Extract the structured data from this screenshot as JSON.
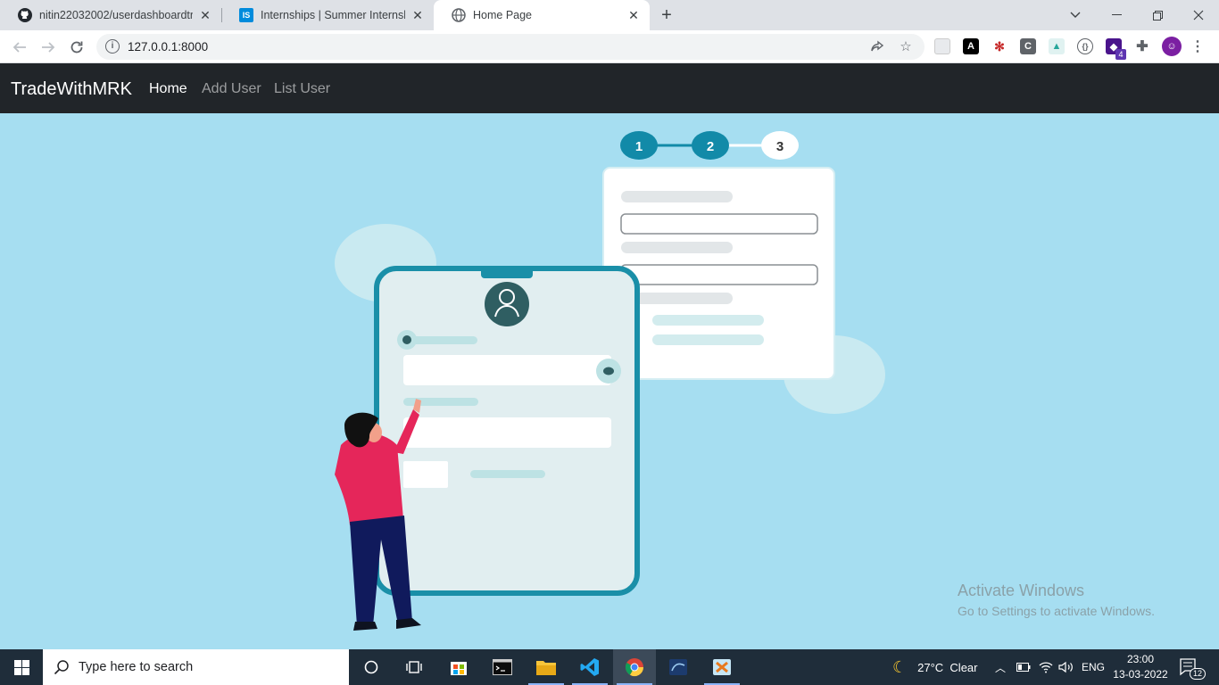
{
  "browser": {
    "tabs": [
      {
        "title": "nitin22032002/userdashboardtra",
        "icon": "github-icon"
      },
      {
        "title": "Internships | Summer Internship",
        "icon": "internshala-icon",
        "icon_text": "IS"
      },
      {
        "title": "Home Page",
        "icon": "globe-icon"
      }
    ],
    "url": "127.0.0.1:8000"
  },
  "navbar": {
    "brand": "TradeWithMRK",
    "links": [
      {
        "label": "Home",
        "active": true
      },
      {
        "label": "Add User",
        "active": false
      },
      {
        "label": "List User",
        "active": false
      }
    ]
  },
  "illustration": {
    "steps": [
      "1",
      "2",
      "3"
    ],
    "colors": {
      "background": "#a6def1",
      "accent": "#128aa8",
      "avatar": "#2f5e62",
      "shirt": "#e5265a",
      "pants": "#101a5c"
    }
  },
  "watermark": {
    "line1": "Activate Windows",
    "line2": "Go to Settings to activate Windows."
  },
  "taskbar": {
    "search_placeholder": "Type here to search",
    "weather": "27°C  Clear",
    "language": "ENG",
    "time": "23:00",
    "date": "13-03-2022",
    "notifications": "12"
  }
}
